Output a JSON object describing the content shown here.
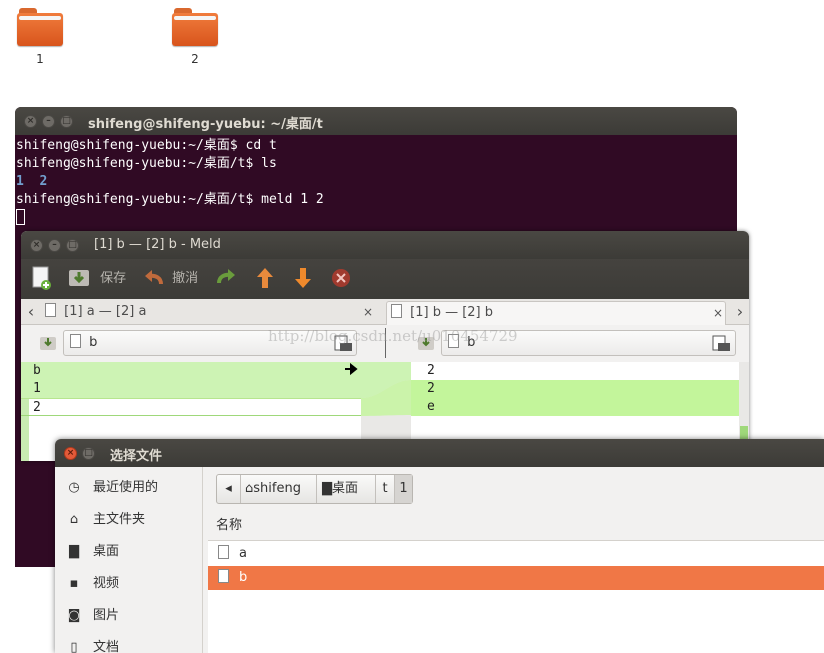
{
  "desktop": {
    "icons": [
      {
        "label": "1"
      },
      {
        "label": "2"
      }
    ]
  },
  "terminal": {
    "title": "shifeng@shifeng-yuebu: ~/桌面/t",
    "lines": [
      "shifeng@shifeng-yuebu:~/桌面$ cd t",
      "shifeng@shifeng-yuebu:~/桌面/t$ ls",
      "shifeng@shifeng-yuebu:~/桌面/t$ meld 1 2"
    ],
    "ls_output": [
      "1",
      "2"
    ]
  },
  "meld": {
    "title": "[1] b — [2] b - Meld",
    "toolbar": {
      "save_label": "保存",
      "undo_label": "撤消"
    },
    "tabs": [
      {
        "label": "[1] a — [2] a",
        "close": "×"
      },
      {
        "label": "[1] b — [2] b",
        "close": "×"
      }
    ],
    "left_path": "b",
    "right_path": "b",
    "left_lines": [
      "b",
      "1",
      "2"
    ],
    "right_lines": [
      "2",
      "2",
      "e"
    ],
    "watermark": "http://blog.csdn.net/u010454729"
  },
  "chooser": {
    "title": "选择文件",
    "sidebar": [
      {
        "label": "最近使用的",
        "icon": "clock-icon"
      },
      {
        "label": "主文件夹",
        "icon": "home-icon"
      },
      {
        "label": "桌面",
        "icon": "folder-icon"
      },
      {
        "label": "视频",
        "icon": "video-icon"
      },
      {
        "label": "图片",
        "icon": "camera-icon"
      },
      {
        "label": "文档",
        "icon": "document-icon"
      }
    ],
    "breadcrumbs": [
      "shifeng",
      "桌面",
      "t",
      "1"
    ],
    "column_header": "名称",
    "files": [
      {
        "name": "a"
      },
      {
        "name": "b"
      }
    ],
    "accent": "#f07746"
  }
}
